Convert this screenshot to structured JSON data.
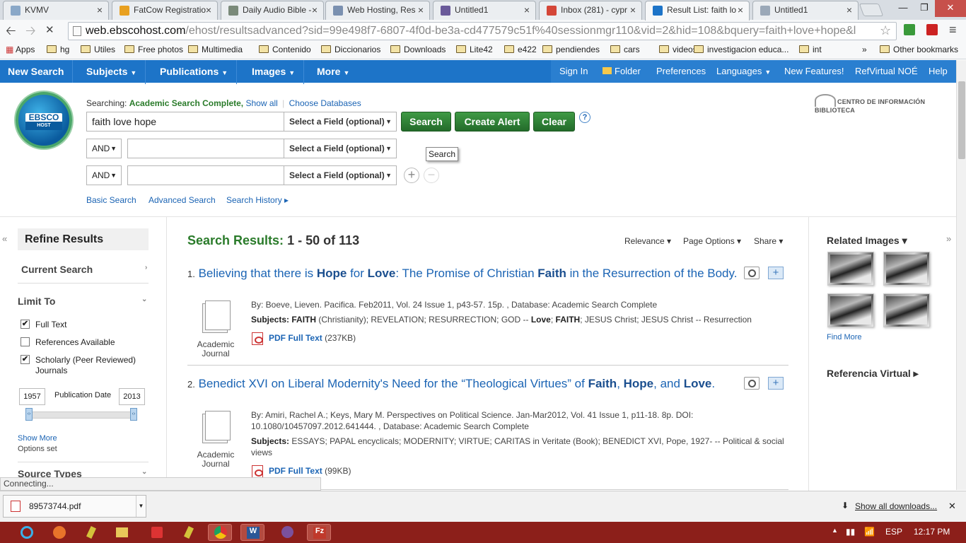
{
  "browser": {
    "tabs": [
      {
        "label": "KVMV",
        "color": "#8aa8c8"
      },
      {
        "label": "FatCow Registratio",
        "color": "#e8a020"
      },
      {
        "label": "Daily Audio Bible -",
        "color": "#7a8a7a"
      },
      {
        "label": "Web Hosting, Res",
        "color": "#7a90b0"
      },
      {
        "label": "Untitled1",
        "color": "#6a5a9a"
      },
      {
        "label": "Inbox (281) - cypr",
        "color": "#d44638"
      },
      {
        "label": "Result List: faith lo",
        "color": "#1d74c8"
      },
      {
        "label": "Untitled1",
        "color": "#9aa8b8"
      }
    ],
    "window_controls": [
      "—",
      "❐",
      "✕"
    ],
    "url_domain": "web.ebscohost.com",
    "url_rest": "/ehost/resultsadvanced?sid=99e498f7-6807-4f0d-be3a-cd477579c51f%40sessionmgr110&vid=2&hid=108&bquery=faith+love+hope&l",
    "bookmarks": [
      "Apps",
      "hg",
      "Utiles",
      "Free photos",
      "Multimedia",
      "Contenido",
      "Diccionarios",
      "Downloads",
      "Lite42",
      "e422",
      "pendiendes",
      "cars",
      "videos",
      "investigacion educa...",
      "int",
      "»",
      "Other bookmarks"
    ]
  },
  "nav": {
    "left": [
      "New Search",
      "Subjects",
      "Publications",
      "Images",
      "More"
    ],
    "right": [
      "Sign In",
      "Folder",
      "Preferences",
      "Languages",
      "New Features!",
      "RefVirtual NOÉ",
      "Help"
    ]
  },
  "logo": {
    "top": "EBSCO",
    "bottom": "HOST"
  },
  "search": {
    "searching_label": "Searching:",
    "database": "Academic Search Complete,",
    "show_all": "Show all",
    "choose_db": "Choose Databases",
    "query": "faith love hope",
    "field_placeholder": "Select a Field (optional)",
    "bool": [
      "AND",
      "AND"
    ],
    "btn_search": "Search",
    "btn_alert": "Create Alert",
    "btn_clear": "Clear",
    "help": "?",
    "tooltip": "Search",
    "plus": "+",
    "minus": "−",
    "links": [
      "Basic Search",
      "Advanced Search",
      "Search History ▸"
    ]
  },
  "institution": "CENTRO DE INFORMACIÓN BIBLIOTECA",
  "sidebar": {
    "collapse": "«",
    "refine": "Refine Results",
    "current_search": "Current Search",
    "limit_to": "Limit To",
    "checks": [
      {
        "label": "Full Text",
        "checked": true,
        "mark": "✔"
      },
      {
        "label": "References Available",
        "checked": false,
        "mark": ""
      },
      {
        "label": "Scholarly (Peer Reviewed) Journals",
        "checked": true,
        "mark": "✔"
      }
    ],
    "year_from": "1957",
    "year_to": "2013",
    "pub_date": "Publication Date",
    "show_more": "Show More",
    "options_set": "Options set",
    "source_types": "Source Types"
  },
  "results": {
    "heading": "Search Results:",
    "count": "1 - 50 of 113",
    "relevance": "Relevance ▾",
    "page_options": "Page Options ▾",
    "share": "Share ▾",
    "items": [
      {
        "num": "1.",
        "title_parts": [
          [
            "Believing that there is ",
            false
          ],
          [
            "Hope",
            true
          ],
          [
            " for ",
            false
          ],
          [
            "Love",
            true
          ],
          [
            ": The Promise of Christian ",
            false
          ],
          [
            "Faith",
            true
          ],
          [
            " in the Resurrection of the Body.",
            false
          ]
        ],
        "type": "Academic Journal",
        "byline": "By: Boeve, Lieven. Pacifica. Feb2011, Vol. 24 Issue 1, p43-57. 15p. , Database: Academic Search Complete",
        "subjects_label": "Subjects:",
        "subjects_parts": [
          [
            "FAITH",
            true
          ],
          [
            " (Christianity); REVELATION; RESURRECTION; GOD -- ",
            false
          ],
          [
            "Love",
            true
          ],
          [
            "; ",
            false
          ],
          [
            "FAITH",
            true
          ],
          [
            "; JESUS Christ; JESUS Christ -- Resurrection",
            false
          ]
        ],
        "pdf": "PDF Full Text",
        "size": "(237KB)"
      },
      {
        "num": "2.",
        "title_parts": [
          [
            "Benedict XVI on Liberal Modernity's Need for the “Theological Virtues” of ",
            false
          ],
          [
            "Faith",
            true
          ],
          [
            ", ",
            false
          ],
          [
            "Hope",
            true
          ],
          [
            ", and ",
            false
          ],
          [
            "Love",
            true
          ],
          [
            ".",
            false
          ]
        ],
        "type": "Academic Journal",
        "byline": "By: Amiri, Rachel A.; Keys, Mary M. Perspectives on Political Science. Jan-Mar2012, Vol. 41 Issue 1, p11-18. 8p. DOI: 10.1080/10457097.2012.641444. , Database: Academic Search Complete",
        "subjects_label": "Subjects:",
        "subjects_parts": [
          [
            "ESSAYS; PAPAL encyclicals; MODERNITY; VIRTUE; CARITAS in Veritate (Book); BENEDICT XVI, Pope, 1927- -- Political & social views",
            false
          ]
        ],
        "pdf": "PDF Full Text",
        "size": "(99KB)"
      }
    ]
  },
  "right_panel": {
    "collapse": "»",
    "related_images": "Related Images ▾",
    "find_more": "Find More",
    "ref_virtual": "Referencia Virtual ▸"
  },
  "status": "Connecting...",
  "download": {
    "file": "89573744.pdf",
    "show_all": "Show all downloads...",
    "close": "✕"
  },
  "taskbar": {
    "lang": "ESP",
    "time": "12:17 PM"
  }
}
